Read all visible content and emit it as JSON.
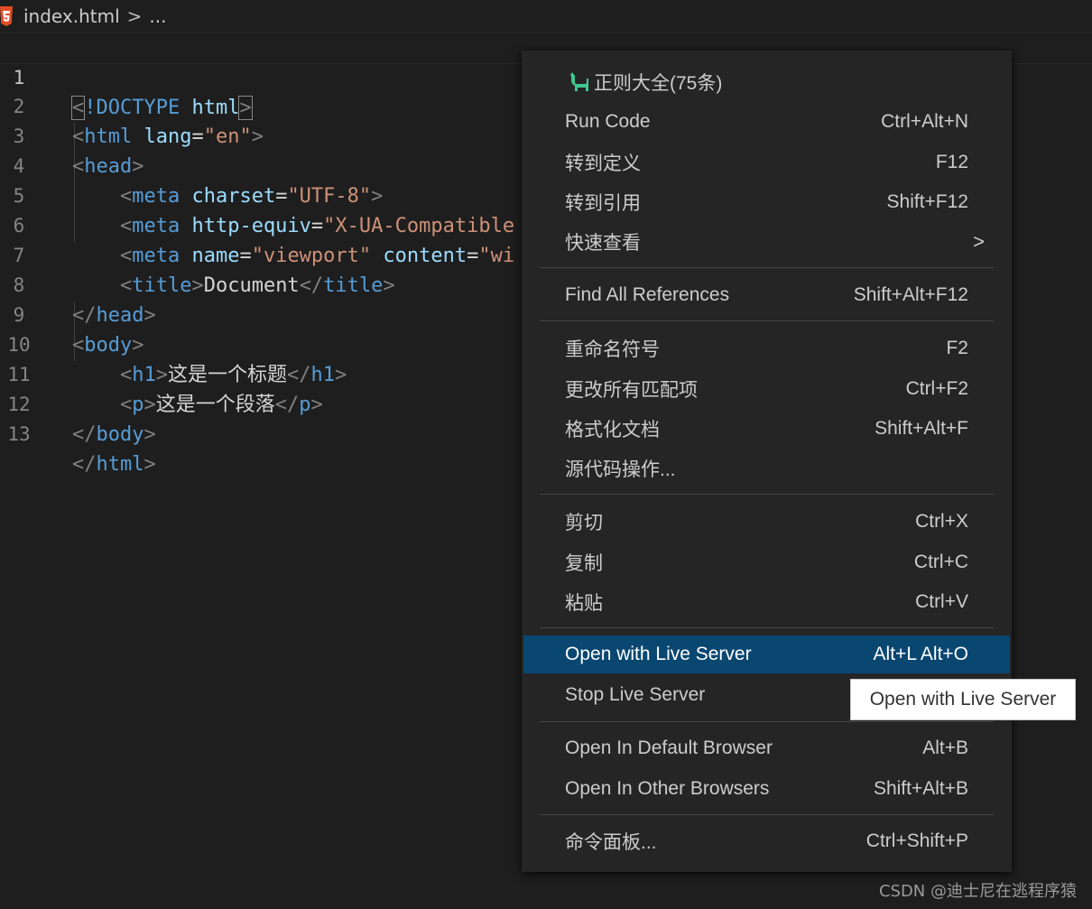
{
  "breadcrumb": {
    "file": "index.html",
    "sep": ">",
    "more": "..."
  },
  "editor": {
    "lines": [
      {
        "n": "1"
      },
      {
        "n": "2"
      },
      {
        "n": "3"
      },
      {
        "n": "4"
      },
      {
        "n": "5"
      },
      {
        "n": "6"
      },
      {
        "n": "7"
      },
      {
        "n": "8"
      },
      {
        "n": "9"
      },
      {
        "n": "10"
      },
      {
        "n": "11"
      },
      {
        "n": "12"
      },
      {
        "n": "13"
      }
    ],
    "tokens": {
      "lt": "<",
      "ltslash": "</",
      "gt": ">",
      "eq": "=",
      "doctype": "!DOCTYPE",
      "html": "html",
      "head": "head",
      "meta": "meta",
      "title": "title",
      "body": "body",
      "h1": "h1",
      "p": "p",
      "lang": "lang",
      "charset": "charset",
      "http_equiv": "http-equiv",
      "name": "name",
      "content": "content",
      "s_en": "\"en\"",
      "s_utf8": "\"UTF-8\"",
      "s_xua": "\"X-UA-Compatible",
      "s_viewport": "\"viewport\"",
      "s_wi": "\"wi",
      "txt_document": "Document",
      "txt_h1": "这是一个标题",
      "txt_p": "这是一个段落"
    }
  },
  "menu": {
    "items": [
      {
        "label": "正则大全(75条)",
        "key": ""
      },
      {
        "label": "Run Code",
        "key": "Ctrl+Alt+N"
      },
      {
        "label": "转到定义",
        "key": "F12"
      },
      {
        "label": "转到引用",
        "key": "Shift+F12"
      },
      {
        "label": "快速查看",
        "key": "",
        "arrow": ">"
      },
      {
        "label": "Find All References",
        "key": "Shift+Alt+F12"
      },
      {
        "label": "重命名符号",
        "key": "F2"
      },
      {
        "label": "更改所有匹配项",
        "key": "Ctrl+F2"
      },
      {
        "label": "格式化文档",
        "key": "Shift+Alt+F"
      },
      {
        "label": "源代码操作...",
        "key": ""
      },
      {
        "label": "剪切",
        "key": "Ctrl+X"
      },
      {
        "label": "复制",
        "key": "Ctrl+C"
      },
      {
        "label": "粘贴",
        "key": "Ctrl+V"
      },
      {
        "label": "Open with Live Server",
        "key": "Alt+L Alt+O"
      },
      {
        "label": "Stop Live Server",
        "key": ""
      },
      {
        "label": "Open In Default Browser",
        "key": "Alt+B"
      },
      {
        "label": "Open In Other Browsers",
        "key": "Shift+Alt+B"
      },
      {
        "label": "命令面板...",
        "key": "Ctrl+Shift+P"
      }
    ]
  },
  "tooltip": {
    "text": "Open with Live Server"
  },
  "watermark": {
    "text": "CSDN @迪士尼在逃程序猿"
  },
  "colors": {
    "background": "#1e1e1e",
    "menu_bg": "#252526",
    "highlight": "#094771",
    "tag": "#569cd6",
    "attr": "#9cdcfe",
    "string": "#ce9178",
    "icon_green": "#3fc98f",
    "html5": "#e44d26"
  },
  "icons": {
    "file": "html5-icon",
    "menu_first": "cat-icon",
    "submenu": "chevron-right-icon"
  }
}
